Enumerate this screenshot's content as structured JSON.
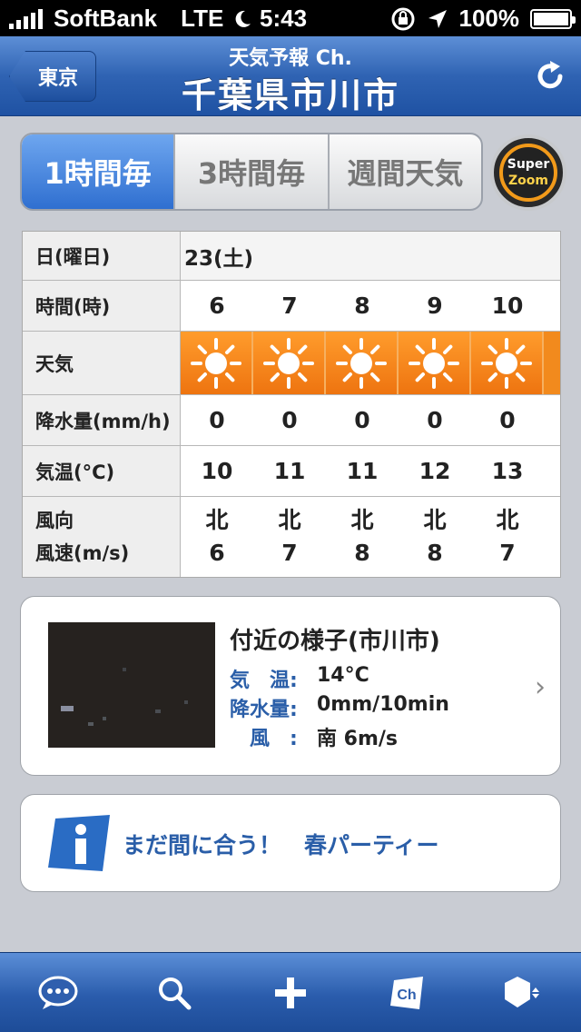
{
  "status_bar": {
    "carrier": "SoftBank",
    "network": "LTE",
    "time": "5:43",
    "battery": "100%"
  },
  "nav": {
    "back_label": "東京",
    "subtitle": "天気予報 Ch.",
    "title": "千葉県市川市"
  },
  "segments": [
    {
      "label": "1時間毎",
      "active": true
    },
    {
      "label": "3時間毎",
      "active": false
    },
    {
      "label": "週間天気",
      "active": false
    }
  ],
  "superzoom": {
    "line1": "Super",
    "line2": "Zoom"
  },
  "forecast": {
    "labels": {
      "date": "日(曜日)",
      "time": "時間(時)",
      "weather": "天気",
      "precip": "降水量(mm/h)",
      "temp": "気温(°C)",
      "wind_dir": "風向",
      "wind_speed": "風速(m/s)"
    },
    "date_value": "23(土)",
    "hours": [
      "6",
      "7",
      "8",
      "9",
      "10"
    ],
    "weather_icons": [
      "sun-icon",
      "sun-icon",
      "sun-icon",
      "sun-icon",
      "sun-icon"
    ],
    "precip": [
      "0",
      "0",
      "0",
      "0",
      "0"
    ],
    "temp": [
      "10",
      "11",
      "11",
      "12",
      "13"
    ],
    "wind_dir": [
      "北",
      "北",
      "北",
      "北",
      "北"
    ],
    "wind_speed": [
      "6",
      "7",
      "8",
      "8",
      "7"
    ]
  },
  "nearby": {
    "title": "付近の様子(市川市)",
    "temp_label": "気　温:",
    "temp_value": "14°C",
    "precip_label": "降水量:",
    "precip_value": "0mm/10min",
    "wind_label": "　風　:",
    "wind_value": "南 6m/s"
  },
  "info": {
    "text": "まだ間に合う！　春パーティー"
  },
  "tabbar": [
    "chat-bubble-icon",
    "search-icon",
    "plus-icon",
    "channel-icon",
    "settings-hexagon-icon"
  ],
  "colors": {
    "accent_blue": "#2f63b3",
    "weather_orange": "#f28a1d",
    "link_blue": "#2a5ea8"
  }
}
